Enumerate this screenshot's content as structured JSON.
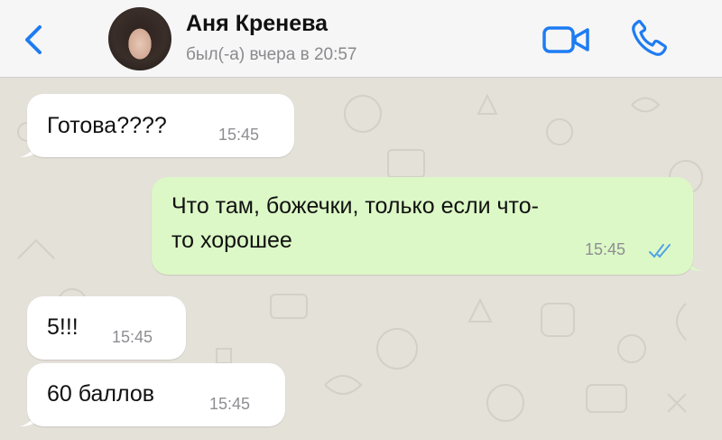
{
  "header": {
    "contact_name": "Аня Кренева",
    "last_seen": "был(-а) вчера в 20:57"
  },
  "messages": [
    {
      "direction": "incoming",
      "text": "Готова????",
      "time": "15:45"
    },
    {
      "direction": "outgoing",
      "text_line1": "Что там, божечки, только если что-",
      "text_line2": "то хорошее",
      "time": "15:45",
      "status": "read"
    },
    {
      "direction": "incoming",
      "text": "5!!!",
      "time": "15:45"
    },
    {
      "direction": "incoming",
      "text": "60 баллов",
      "time": "15:45"
    }
  ],
  "colors": {
    "accent": "#1e7cf2",
    "outgoing_bubble": "#dcf8c6",
    "incoming_bubble": "#ffffff",
    "chat_background": "#e4e1d9",
    "read_ticks": "#4fa3e8"
  }
}
